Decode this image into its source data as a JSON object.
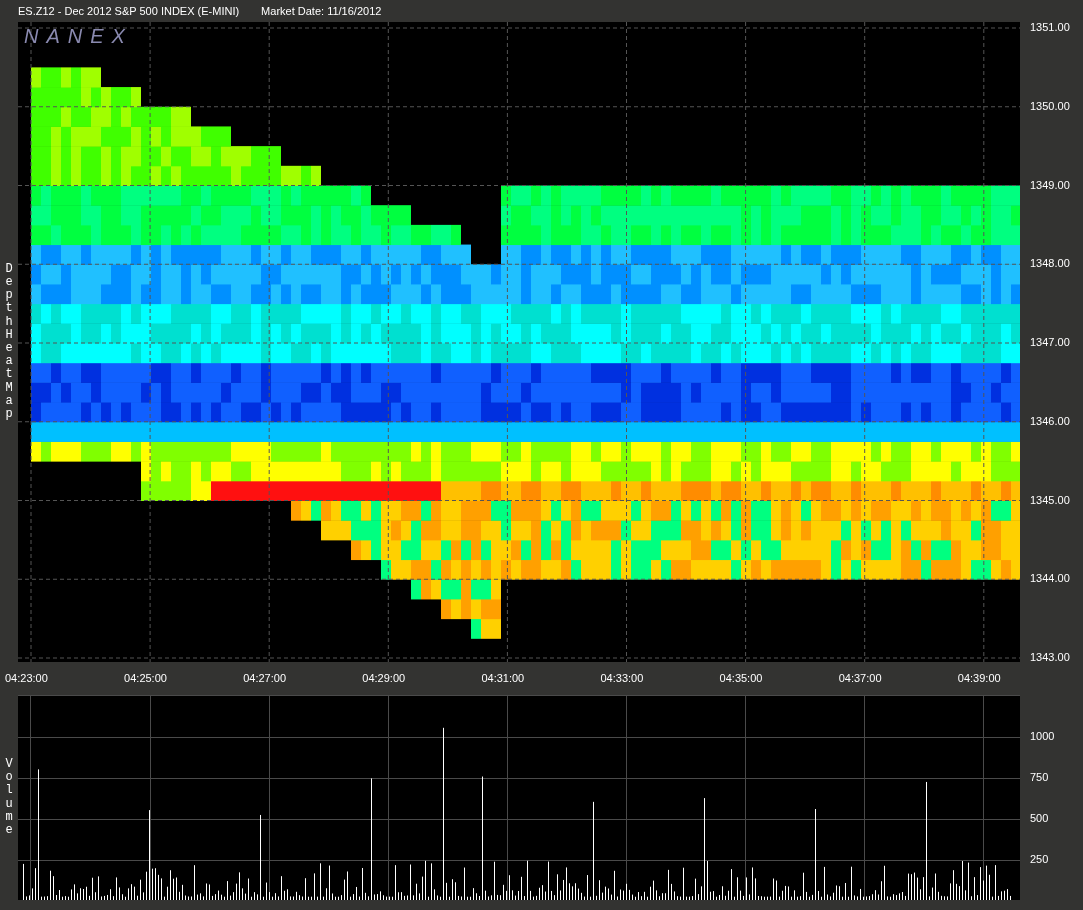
{
  "header": {
    "symbol": "ES.Z12 - Dec 2012 S&P 500 INDEX (E-MINI)",
    "market_date": "Market Date: 11/16/2012"
  },
  "heatmap": {
    "logo": "NANEX",
    "label": "Depth Heat Map",
    "price_ticks": [
      "1351.00",
      "1350.00",
      "1349.00",
      "1348.00",
      "1347.00",
      "1346.00",
      "1345.00",
      "1344.00",
      "1343.00"
    ],
    "time_ticks": [
      "04:23:00",
      "04:25:00",
      "04:27:00",
      "04:29:00",
      "04:31:00",
      "04:33:00",
      "04:35:00",
      "04:37:00",
      "04:39:00"
    ]
  },
  "volume": {
    "label": "Volume",
    "ticks": [
      "1000",
      "750",
      "500",
      "250"
    ]
  }
}
